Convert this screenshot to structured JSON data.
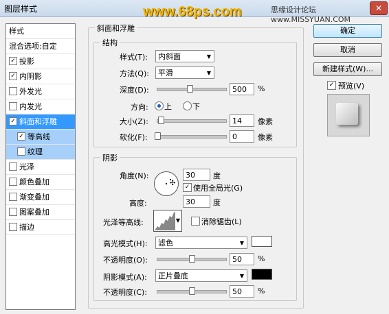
{
  "window": {
    "title": "图层样式",
    "close_glyph": "✕"
  },
  "watermark": {
    "site": "www.68ps.com",
    "forum": "思缘设计论坛 www.MISSYUAN.COM"
  },
  "left_panel": {
    "header": "样式",
    "blend_options": "混合选项:自定",
    "items": [
      {
        "label": "投影",
        "checked": true
      },
      {
        "label": "内阴影",
        "checked": true
      },
      {
        "label": "外发光",
        "checked": false
      },
      {
        "label": "内发光",
        "checked": false
      },
      {
        "label": "斜面和浮雕",
        "checked": true
      },
      {
        "label": "等高线",
        "checked": true
      },
      {
        "label": "纹理",
        "checked": false
      },
      {
        "label": "光泽",
        "checked": false
      },
      {
        "label": "颜色叠加",
        "checked": false
      },
      {
        "label": "渐变叠加",
        "checked": false
      },
      {
        "label": "图案叠加",
        "checked": false
      },
      {
        "label": "描边",
        "checked": false
      }
    ]
  },
  "buttons": {
    "ok": "确定",
    "cancel": "取消",
    "new_style": "新建样式(W)...",
    "preview": "预览(V)",
    "preview_checked": true
  },
  "bevel": {
    "title": "斜面和浮雕",
    "structure": {
      "title": "结构",
      "style_label": "样式(T):",
      "style_value": "内斜面",
      "technique_label": "方法(Q):",
      "technique_value": "平滑",
      "depth_label": "深度(D):",
      "depth_value": "500",
      "depth_unit": "%",
      "depth_pos": 0.47,
      "direction_label": "方向:",
      "dir_up": "上",
      "dir_down": "下",
      "dir_selected": "上",
      "size_label": "大小(Z):",
      "size_value": "14",
      "size_unit": "像素",
      "size_pos": 0.05,
      "soften_label": "软化(F):",
      "soften_value": "0",
      "soften_unit": "像素",
      "soften_pos": 0.0
    },
    "shading": {
      "title": "阴影",
      "angle_label": "角度(N):",
      "angle_value": "30",
      "angle_unit": "度",
      "global_light_label": "使用全局光(G)",
      "global_light_checked": true,
      "altitude_label": "高度:",
      "altitude_value": "30",
      "altitude_unit": "度",
      "gloss_contour_label": "光泽等高线:",
      "antialias_label": "消除锯齿(L)",
      "antialias_checked": false,
      "highlight_mode_label": "高光模式(H):",
      "highlight_mode_value": "滤色",
      "highlight_color": "#ffffff",
      "highlight_opacity_label": "不透明度(O):",
      "highlight_opacity_value": "50",
      "highlight_opacity_unit": "%",
      "highlight_opacity_pos": 0.5,
      "shadow_mode_label": "阴影模式(A):",
      "shadow_mode_value": "正片叠底",
      "shadow_color": "#000000",
      "shadow_opacity_label": "不透明度(C):",
      "shadow_opacity_value": "50",
      "shadow_opacity_unit": "%",
      "shadow_opacity_pos": 0.5
    }
  },
  "icons": {
    "check": "✓",
    "dropdown": "▼",
    "crosshair": "✣"
  }
}
